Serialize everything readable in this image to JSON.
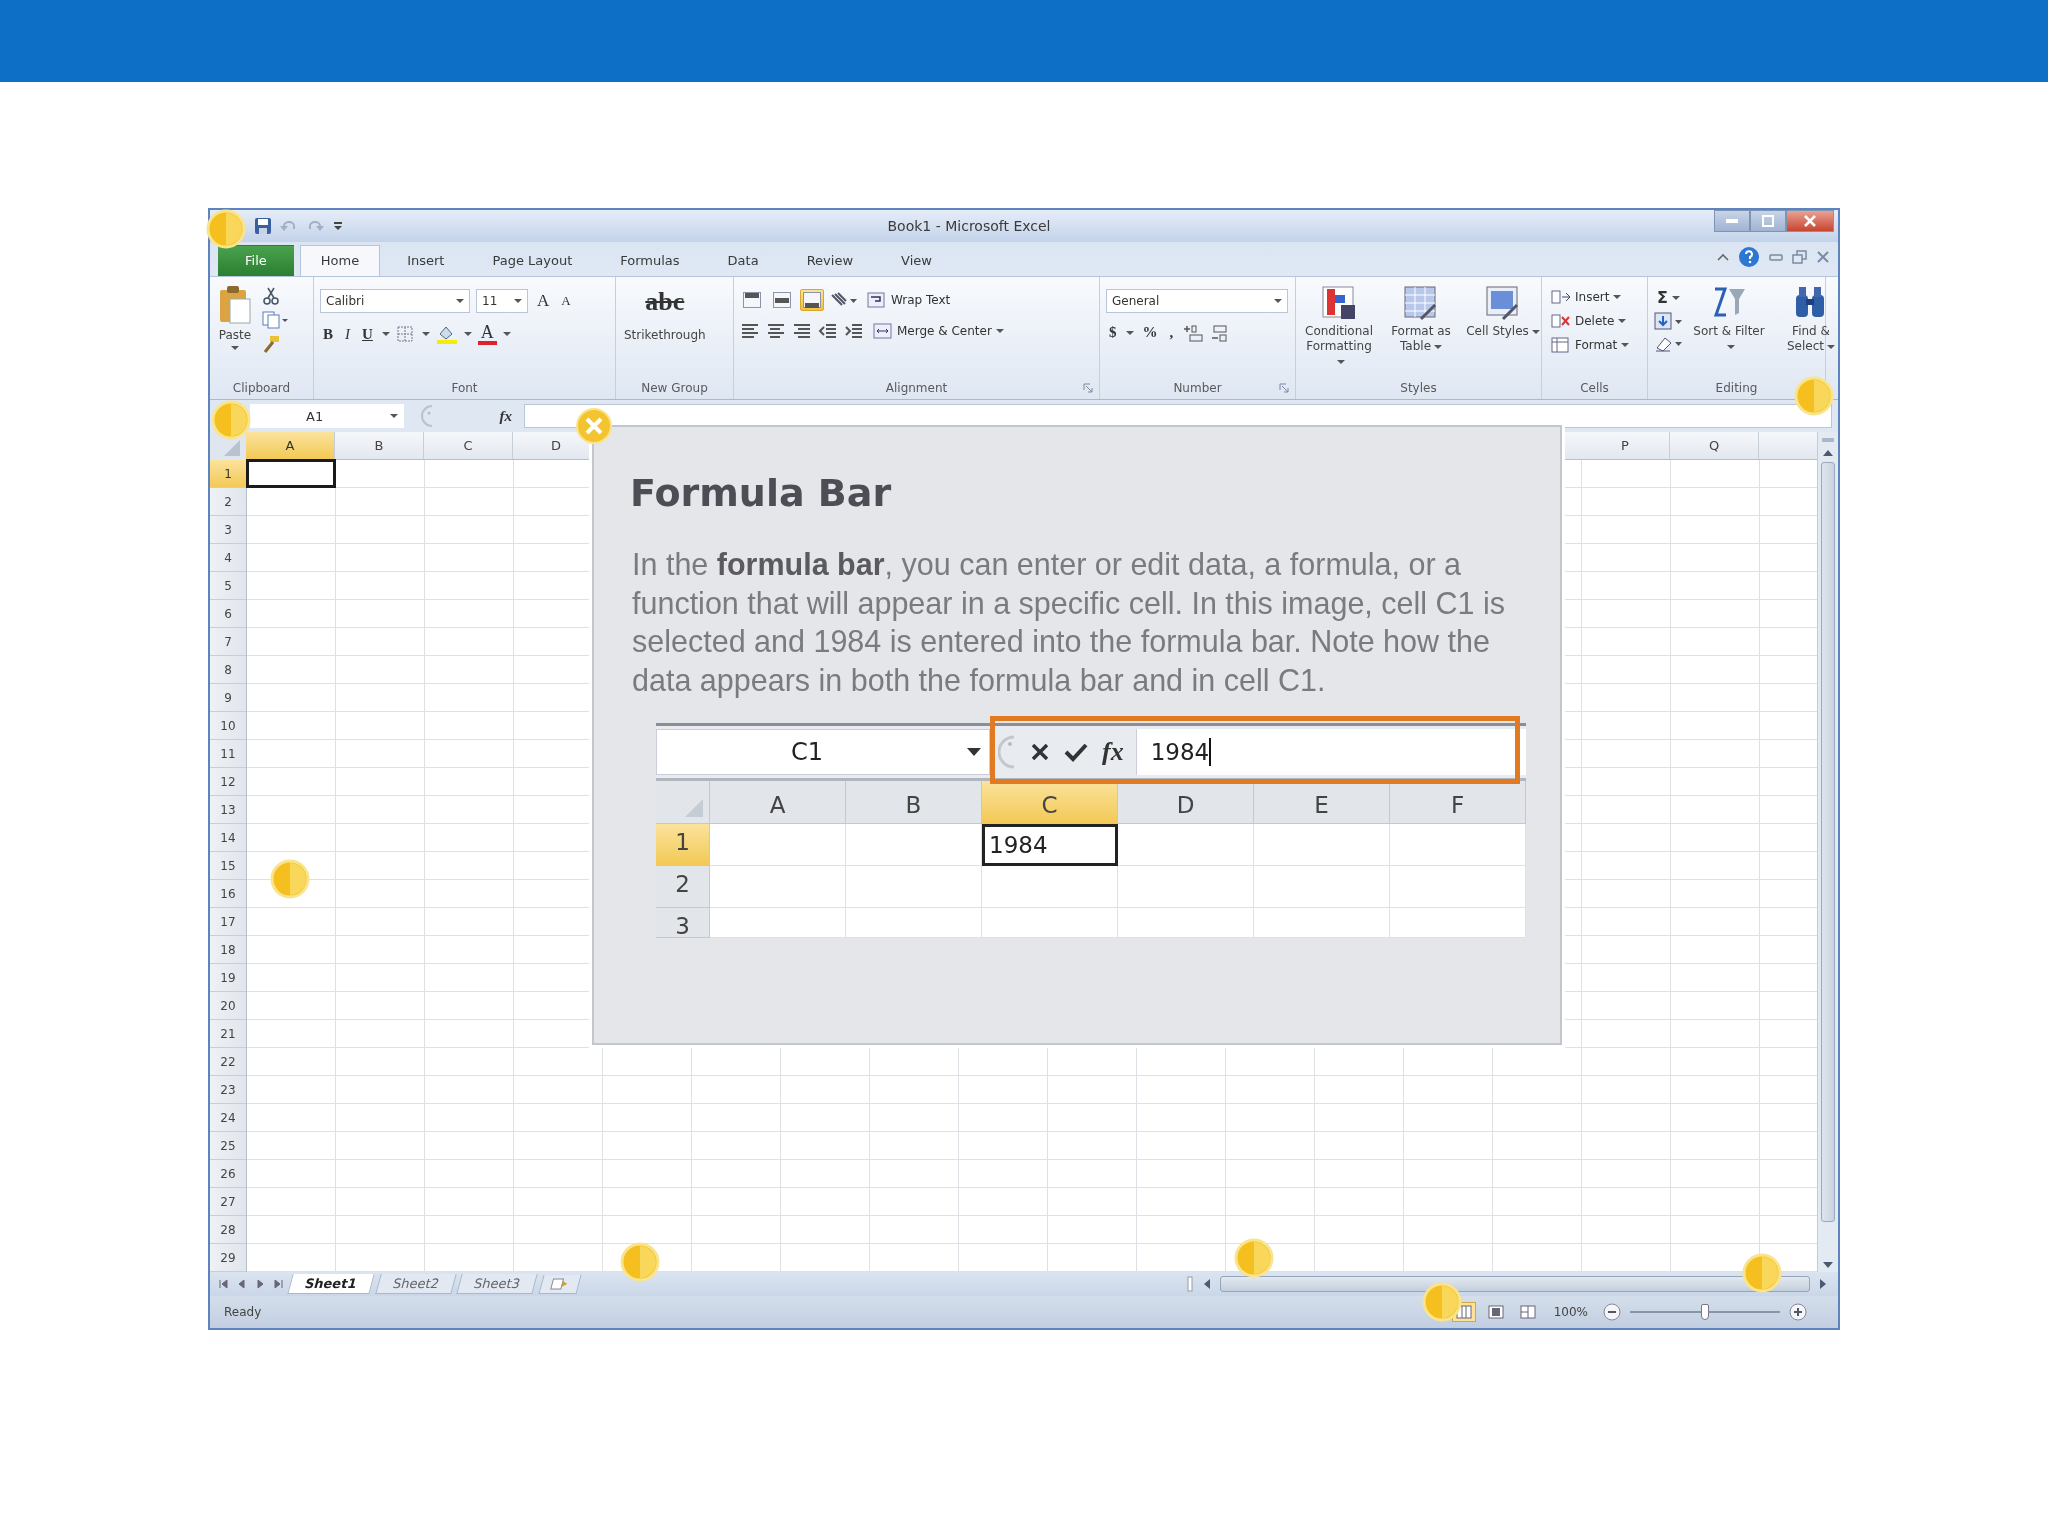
{
  "window": {
    "title": "Book1 - Microsoft Excel"
  },
  "tabs": [
    {
      "label": "File",
      "kind": "backstage",
      "selected": false
    },
    {
      "label": "Home",
      "kind": "tab",
      "selected": true
    },
    {
      "label": "Insert",
      "kind": "tab",
      "selected": false
    },
    {
      "label": "Page Layout",
      "kind": "tab",
      "selected": false
    },
    {
      "label": "Formulas",
      "kind": "tab",
      "selected": false
    },
    {
      "label": "Data",
      "kind": "tab",
      "selected": false
    },
    {
      "label": "Review",
      "kind": "tab",
      "selected": false
    },
    {
      "label": "View",
      "kind": "tab",
      "selected": false
    }
  ],
  "ribbon": {
    "groups": [
      {
        "kind": "clipboard",
        "label": "Clipboard",
        "paste": "Paste"
      },
      {
        "kind": "font",
        "label": "Font",
        "font_name": "Calibri",
        "size_field": "11",
        "grow": "A",
        "shrink": "A",
        "bold": "B",
        "italic": "I",
        "underline": "U",
        "font_color": "A"
      },
      {
        "kind": "custom",
        "label": "New Group",
        "sample": "abc",
        "command": "Strikethrough"
      },
      {
        "kind": "alignment",
        "label": "Alignment",
        "vertical_align": [
          {
            "selected": false
          },
          {
            "selected": false
          },
          {
            "selected": true
          }
        ],
        "wrap": "Wrap Text",
        "merge": "Merge & Center"
      },
      {
        "kind": "number",
        "label": "Number",
        "format": "General",
        "currency": "$",
        "percent": "%",
        "comma": ","
      },
      {
        "kind": "styles",
        "label": "Styles",
        "items": [
          "Conditional Formatting",
          "Format as Table",
          "Cell Styles"
        ]
      },
      {
        "kind": "cells",
        "label": "Cells",
        "items": [
          "Insert",
          "Delete",
          "Format"
        ]
      },
      {
        "kind": "editing",
        "label": "Editing",
        "sum": "Σ",
        "items": [
          "Sort & Filter",
          "Find & Select"
        ]
      }
    ]
  },
  "formula_bar": {
    "name_box": "A1",
    "function_label": "fx"
  },
  "sheet": {
    "columns": [
      {
        "label": "A",
        "selected": true
      },
      {
        "label": "B",
        "selected": false
      },
      {
        "label": "C",
        "selected": false
      },
      {
        "label": "D",
        "selected": false
      },
      {
        "label": "P",
        "selected": false
      },
      {
        "label": "Q",
        "selected": false
      }
    ],
    "rows": [
      {
        "label": "1",
        "selected": true
      },
      {
        "label": "2",
        "selected": false
      },
      {
        "label": "3",
        "selected": false
      },
      {
        "label": "4",
        "selected": false
      },
      {
        "label": "5",
        "selected": false
      },
      {
        "label": "6",
        "selected": false
      },
      {
        "label": "7",
        "selected": false
      },
      {
        "label": "8",
        "selected": false
      },
      {
        "label": "9",
        "selected": false
      },
      {
        "label": "10",
        "selected": false
      },
      {
        "label": "11",
        "selected": false
      },
      {
        "label": "12",
        "selected": false
      },
      {
        "label": "13",
        "selected": false
      },
      {
        "label": "14",
        "selected": false
      },
      {
        "label": "15",
        "selected": false
      },
      {
        "label": "16",
        "selected": false
      },
      {
        "label": "17",
        "selected": false
      },
      {
        "label": "18",
        "selected": false
      },
      {
        "label": "19",
        "selected": false
      },
      {
        "label": "20",
        "selected": false
      },
      {
        "label": "21",
        "selected": false
      },
      {
        "label": "22",
        "selected": false
      },
      {
        "label": "23",
        "selected": false
      },
      {
        "label": "24",
        "selected": false
      },
      {
        "label": "25",
        "selected": false
      },
      {
        "label": "26",
        "selected": false
      },
      {
        "label": "27",
        "selected": false
      },
      {
        "label": "28",
        "selected": false
      },
      {
        "label": "29",
        "selected": false
      }
    ]
  },
  "sheet_tabs": [
    {
      "label": "Sheet1",
      "selected": true
    },
    {
      "label": "Sheet2",
      "selected": false
    },
    {
      "label": "Sheet3",
      "selected": false
    }
  ],
  "status_bar": {
    "status": "Ready",
    "views": [
      {
        "selected": true
      },
      {
        "selected": false
      },
      {
        "selected": false
      }
    ],
    "zoom": "100%",
    "zoom_slider": {
      "level": 0.5
    }
  },
  "popup": {
    "title": "Formula Bar",
    "body": "In the **formula bar**, you can enter or edit data, a formula, or a function that will appear in a specific cell. In this image, cell C1 is selected and 1984 is entered into the formula bar. Note how the data appears in both the formula bar and in cell C1.",
    "example": {
      "name_box": "C1",
      "function_label": "fx",
      "value": "1984",
      "columns": [
        {
          "label": "A",
          "selected": false
        },
        {
          "label": "B",
          "selected": false
        },
        {
          "label": "C",
          "selected": true
        },
        {
          "label": "D",
          "selected": false
        },
        {
          "label": "E",
          "selected": false
        },
        {
          "label": "F",
          "selected": false
        }
      ],
      "rows": [
        {
          "label": "1",
          "selected": true,
          "active_cell": "1984"
        },
        {
          "label": "2",
          "selected": false
        },
        {
          "label": "3",
          "selected": false
        }
      ]
    }
  }
}
